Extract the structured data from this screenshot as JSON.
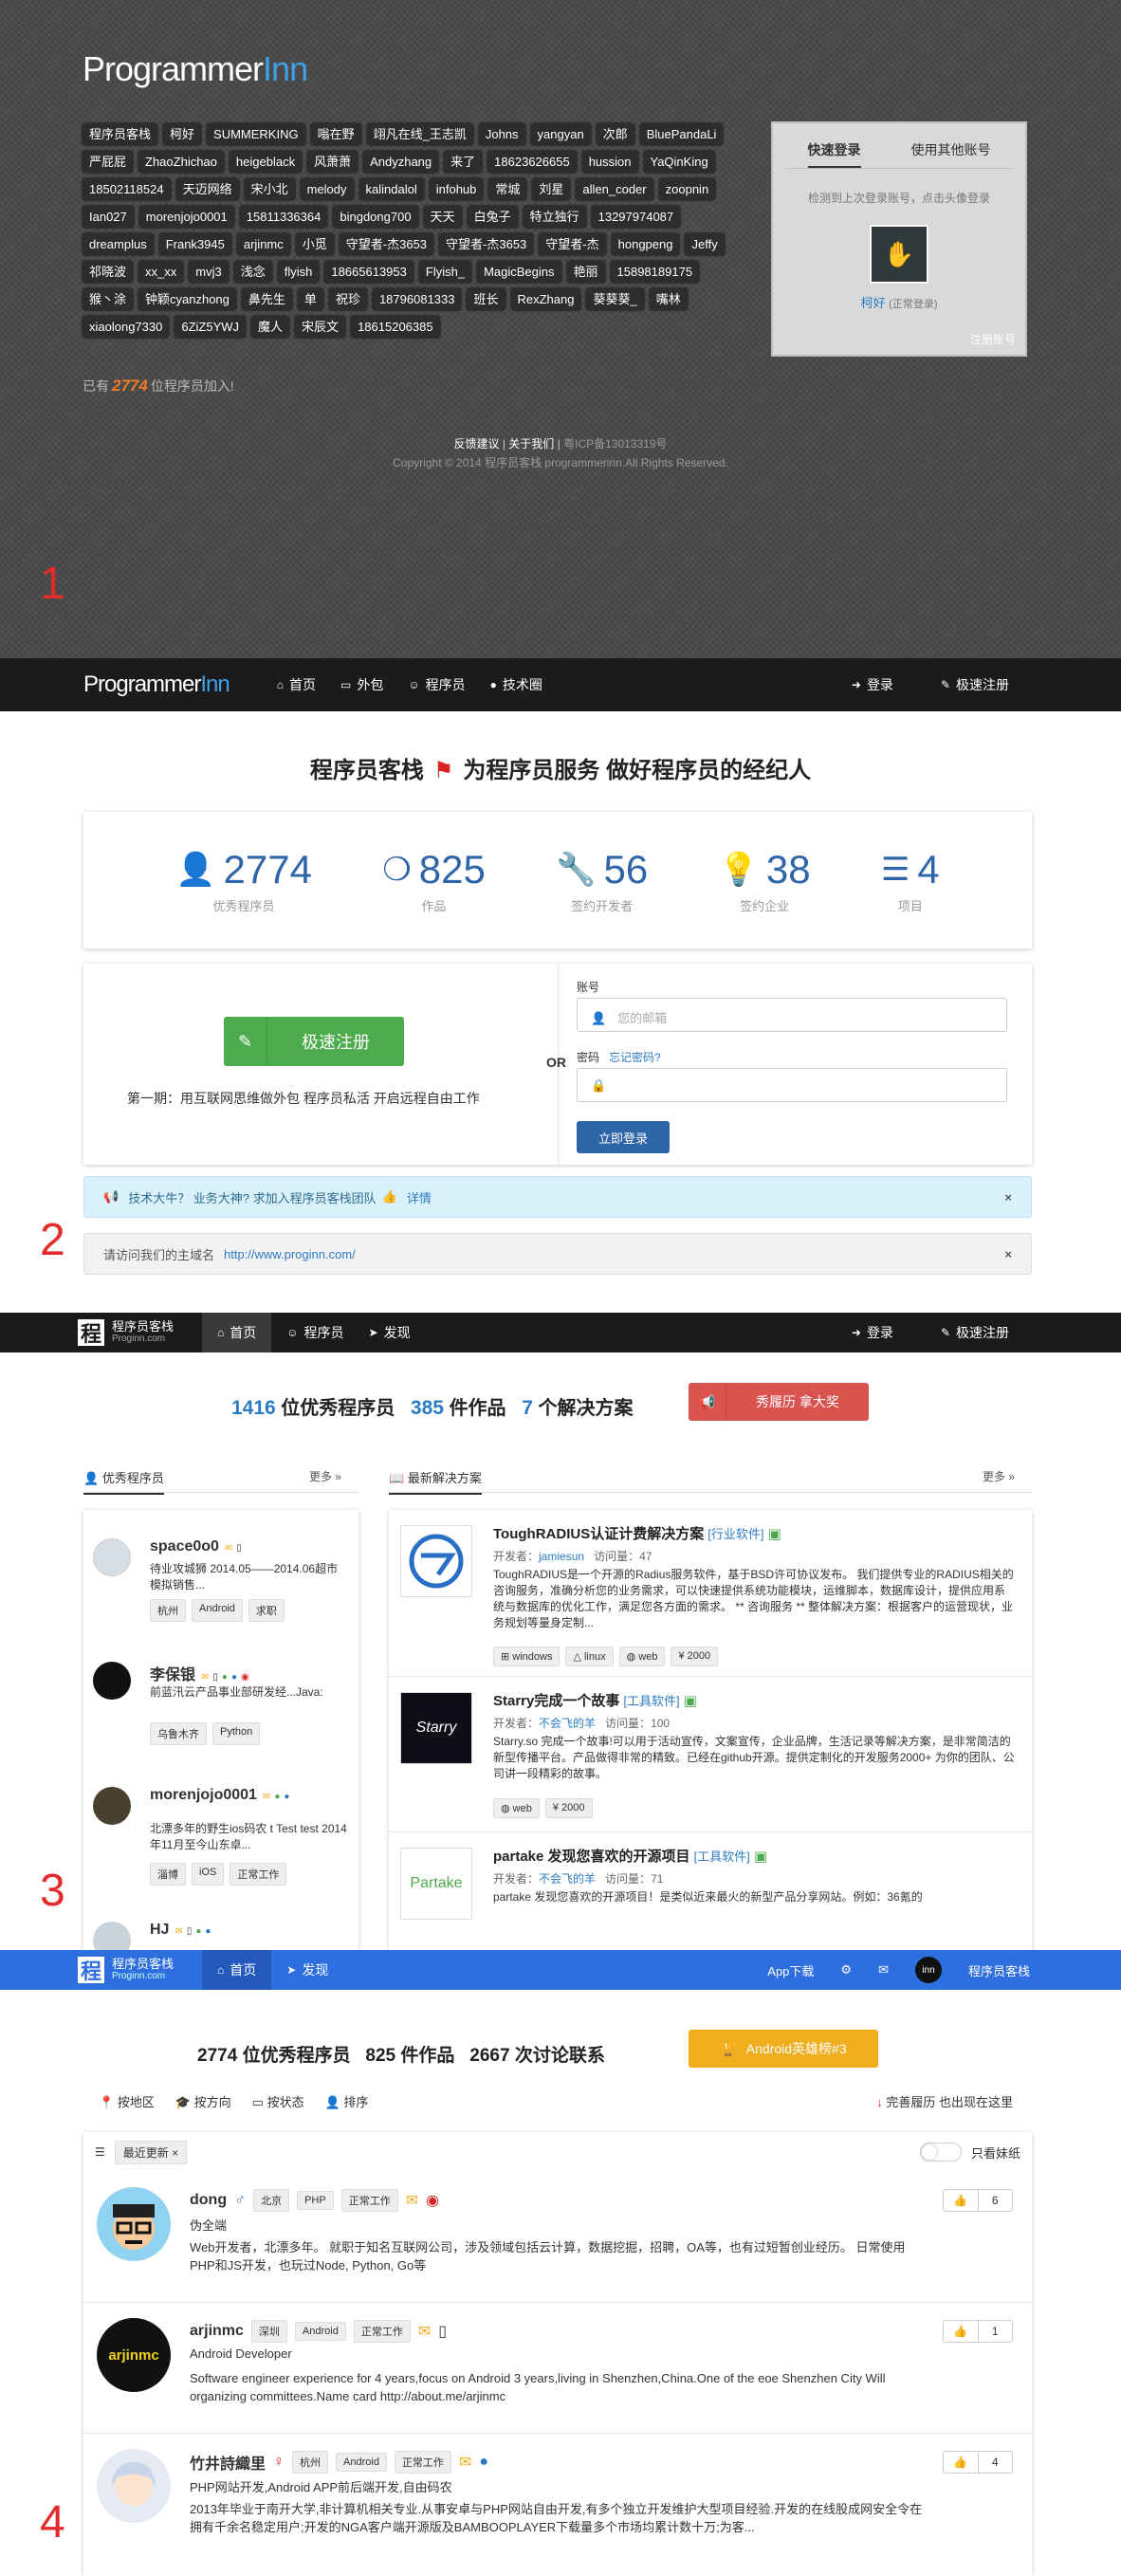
{
  "s1": {
    "logo_main": "Programmer",
    "logo_accent": "Inn",
    "tags": [
      "程序员客栈",
      "柯好",
      "SUMMERKING",
      "嗡在野",
      "翊凡在线_王志凯",
      "Johns",
      "yangyan",
      "次郎",
      "BluePandaLi",
      "严屁屁",
      "ZhaoZhichao",
      "heigeblack",
      "风萧萧",
      "Andyzhang",
      "来了",
      "18623626655",
      "hussion",
      "YaQinKing",
      "18502118524",
      "天迈网络",
      "宋小北",
      "melody",
      "kalindalol",
      "infohub",
      "常城",
      "刘星",
      "allen_coder",
      "zoopnin",
      "Ian027",
      "morenjojo0001",
      "15811336364",
      "bingdong700",
      "天天",
      "白兔子",
      "特立独行",
      "13297974087",
      "dreamplus",
      "Frank3945",
      "arjinmc",
      "小觅",
      "守望者-杰3653",
      "守望者-杰3653",
      "守望者-杰",
      "hongpeng",
      "Jeffy",
      "祁晓波",
      "xx_xx",
      "mvj3",
      "浅念",
      "flyish",
      "18665613953",
      "Flyish_",
      "MagicBegins",
      "艳丽",
      "15898189175",
      "猴丶涂",
      "钟颖cyanzhong",
      "鼻先生",
      "单",
      "祝珍",
      "18796081333",
      "班长",
      "RexZhang",
      "葵葵葵_",
      "嘴林",
      "xiaolong7330",
      "6ZiZ5YWJ",
      "魔人",
      "宋辰文",
      "18615206385"
    ],
    "joined_prefix": "已有",
    "joined_count": "2774",
    "joined_suffix": "位程序员加入!",
    "login_tab_quick": "快速登录",
    "login_tab_other": "使用其他账号",
    "login_hint": "检测到上次登录账号，点击头像登录",
    "login_user": "柯好",
    "login_user_status": "(正常登录)",
    "login_register": "注册账号",
    "footer_feedback": "反馈建议",
    "footer_about": "关于我们",
    "footer_icp": "粤ICP备13013319号",
    "footer_copyright": "Copyright © 2014 程序员客栈 programmerinn.All Rights Reserved.",
    "label": "1"
  },
  "nav2": {
    "logo_main": "Programmer",
    "logo_accent": "Inn",
    "items": [
      "首页",
      "外包",
      "程序员",
      "技术圈"
    ],
    "login": "登录",
    "register": "极速注册"
  },
  "s2": {
    "title_left": "程序员客栈",
    "title_right": "为程序员服务 做好程序员的经纪人",
    "stats": [
      {
        "value": "2774",
        "label": "优秀程序员"
      },
      {
        "value": "825",
        "label": "作品"
      },
      {
        "value": "56",
        "label": "签约开发者"
      },
      {
        "value": "38",
        "label": "签约企业"
      },
      {
        "value": "4",
        "label": "项目"
      }
    ],
    "quick_register": "极速注册",
    "register_text": "第一期：用互联网思维做外包 程序员私活 开启远程自由工作",
    "or": "OR",
    "account_label": "账号",
    "account_placeholder": "您的邮箱",
    "password_label": "密码",
    "forgot": "忘记密码?",
    "login_button": "立即登录",
    "alert_info": "技术大牛？ 业务大神? 求加入程序员客栈团队",
    "alert_info_link": "详情",
    "alert_gray": "请访问我们的主域名",
    "alert_gray_link": "http://www.proginn.com/",
    "label": "2"
  },
  "nav3": {
    "logo_name": "程序员客栈",
    "logo_sub": "Proginn.com",
    "items": [
      "首页",
      "程序员",
      "发现"
    ],
    "login": "登录",
    "register": "极速注册"
  },
  "s3": {
    "dev_count": "1416",
    "dev_label": "位优秀程序员",
    "work_count": "385",
    "work_label": "件作品",
    "sol_count": "7",
    "sol_label": "个解决方案",
    "resume_button": "秀履历 拿大奖",
    "left_title": "优秀程序员",
    "right_title": "最新解决方案",
    "more": "更多 »",
    "devs": [
      {
        "name": "space0o0",
        "desc": "待业攻城狮 2014.05——2014.06超市模拟销售...",
        "tags": [
          "杭州",
          "Android",
          "求职"
        ]
      },
      {
        "name": "李保银",
        "desc": "前蓝汛云产品事业部研发经...Java:",
        "tags": [
          "乌鲁木齐",
          "Python"
        ]
      },
      {
        "name": "morenjojo0001",
        "desc": "北漂多年的野生ios码农 t Test test 2014年11月至今山东卓...",
        "tags": [
          "淄博",
          "iOS",
          "正常工作"
        ]
      },
      {
        "name": "HJ",
        "desc": "",
        "tags": []
      }
    ],
    "solutions": [
      {
        "title": "ToughRADIUS认证计费解决方案",
        "cat": "[行业软件]",
        "dev_label": "开发者：",
        "dev": "jamiesun",
        "views_label": "访问量：",
        "views": "47",
        "desc": "ToughRADIUS是一个开源的Radius服务软件，基于BSD许可协议发布。 我们提供专业的RADIUS相关的咨询服务，准确分析您的业务需求，可以快速提供系统功能模块，运维脚本，数据库设计，提供应用系统与数据库的优化工作，满足您各方面的需求。 ** 咨询服务 ** 整体解决方案：根据客户的运营现状，业务规划等量身定制...",
        "chips": [
          "windows",
          "linux",
          "web",
          "¥ 2000"
        ],
        "logo": ""
      },
      {
        "title": "Starry完成一个故事",
        "cat": "[工具软件]",
        "dev_label": "开发者：",
        "dev": "不会飞的羊",
        "views_label": "访问量：",
        "views": "100",
        "desc": "Starry.so 完成一个故事!可以用于活动宣传，文案宣传，企业品牌，生活记录等解决方案，是非常简洁的新型传播平台。产品做得非常的精致。已经在github开源。提供定制化的开发服务2000+ 为你的团队、公司讲一段精彩的故事。",
        "chips": [
          "web",
          "¥ 2000"
        ],
        "logo": "Starry"
      },
      {
        "title": "partake 发现您喜欢的开源项目",
        "cat": "[工具软件]",
        "dev_label": "开发者：",
        "dev": "不会飞的羊",
        "views_label": "访问量：",
        "views": "71",
        "desc": "partake 发现您喜欢的开源项目！是类似近来最火的新型产品分享网站。例如：36氪的",
        "chips": [],
        "logo": "Partake"
      }
    ],
    "label": "3"
  },
  "nav4": {
    "logo_name": "程序员客栈",
    "logo_sub": "Proginn.com",
    "items": [
      "首页",
      "发现"
    ],
    "app": "App下载",
    "inn": "inn",
    "user": "程序员客栈"
  },
  "s4": {
    "dev_count": "2774",
    "dev_label": "位优秀程序员",
    "work_count": "825",
    "work_label": "件作品",
    "disc_count": "2667",
    "disc_label": "次讨论联系",
    "hero_button": "Android英雄榜#3",
    "filters": [
      "按地区",
      "按方向",
      "按状态",
      "排序"
    ],
    "right_filter": "完善履历 也出现在这里",
    "pill": "最近更新",
    "toggle_label": "只看妹纸",
    "rows": [
      {
        "name": "dong",
        "tags": [
          "北京",
          "PHP",
          "正常工作"
        ],
        "role": "伪全端",
        "desc": "Web开发者，北漂多年。 就职于知名互联网公司，涉及领域包括云计算，数据挖掘，招聘，OA等，也有过短暂创业经历。 日常使用PHP和JS开发，也玩过Node, Python, Go等",
        "likes": "6"
      },
      {
        "name": "arjinmc",
        "tags": [
          "深圳",
          "Android",
          "正常工作"
        ],
        "role": "Android Developer",
        "desc": "Software engineer experience for 4 years,focus on Android 3 years,living in Shenzhen,China.One of the eoe Shenzhen City Will organizing committees.Name card http://about.me/arjinmc",
        "likes": "1"
      },
      {
        "name": "竹井詩織里",
        "tags": [
          "杭州",
          "Android",
          "正常工作"
        ],
        "role": "PHP网站开发,Android APP前后端开发,自由码农",
        "desc": "2013年毕业于南开大学,非计算机相关专业.从事安卓与PHP网站自由开发,有多个独立开发维护大型项目经验.开发的在线股成网安全令在拥有千余名稳定用户;开发的NGA客户端开源版及BAMBOOPLAYER下载量多个市场均累计数十万;为客...",
        "likes": "4"
      }
    ],
    "avatar_text": "arjinmc",
    "label": "4"
  }
}
